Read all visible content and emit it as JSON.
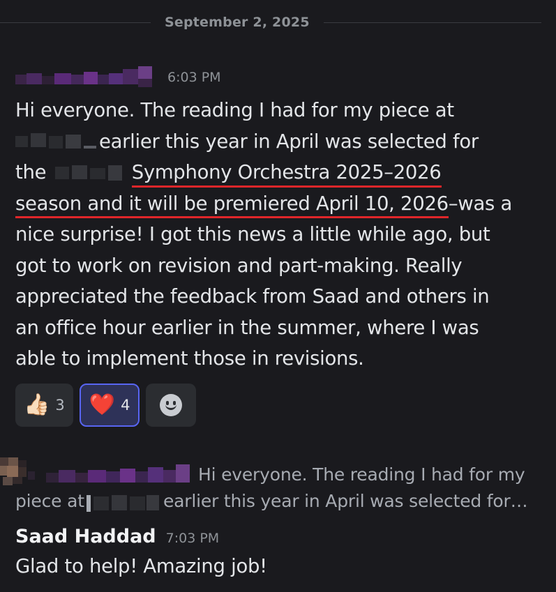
{
  "divider": {
    "date": "September 2, 2025"
  },
  "message1": {
    "author_redacted": true,
    "timestamp": "6:03 PM",
    "lines": {
      "l1": "Hi everyone. The reading I had for my piece at",
      "l2": "earlier this year in April was selected for",
      "l3_pre": "the",
      "l3_underlined": "Symphony Orchestra 2025–2026",
      "l4_underlined": "season and it will be premiered April 10, 2026",
      "l4_post": "–was a",
      "l5": "nice surprise! I got this news a little while ago, but",
      "l6": "got to work on revision and part-making. Really",
      "l7": "appreciated the feedback from Saad and others in",
      "l8": "an office hour earlier in the summer, where I was",
      "l9": "able to implement those in revisions."
    },
    "annotation_color": "#e0262a"
  },
  "reactions": [
    {
      "emoji": "👍🏻",
      "icon": "thumbs-up-icon",
      "count": "3",
      "active": false
    },
    {
      "emoji": "❤️",
      "icon": "red-heart-icon",
      "count": "4",
      "active": true
    }
  ],
  "add_reaction": {
    "icon": "add-reaction-smiley-icon"
  },
  "reply_preview": {
    "line1": "Hi everyone. The reading I had for my",
    "line2_pre": "piece at",
    "line2_post": "earlier this year in April was selected for…"
  },
  "message2": {
    "author": "Saad Haddad",
    "timestamp": "7:03 PM",
    "text": "Glad to help! Amazing job!"
  },
  "colors": {
    "background": "#1a1a1e",
    "text": "#e3e5e8",
    "muted": "#8e9297",
    "active_reaction_border": "#5865f2",
    "redaction_purple": "#5a2a78"
  }
}
